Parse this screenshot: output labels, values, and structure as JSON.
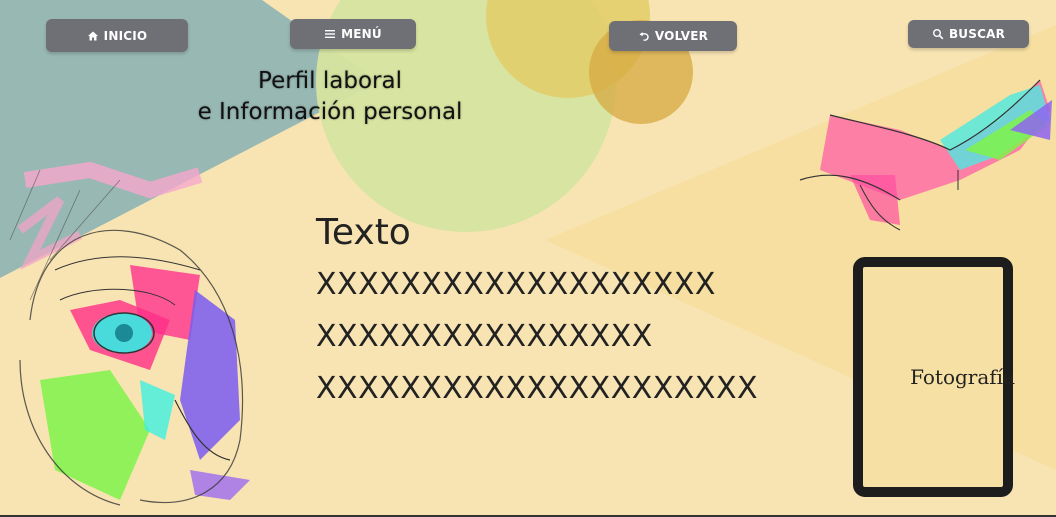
{
  "nav": {
    "inicio": "INICIO",
    "menu": "MENÚ",
    "volver": "VOLVER",
    "buscar": "BUSCAR"
  },
  "icons": {
    "inicio": "home-icon",
    "menu": "hamburger-menu-icon",
    "volver": "undo-arrow-icon",
    "buscar": "search-icon"
  },
  "header": {
    "title_line1": "Perfil laboral",
    "title_line2": "e Información personal"
  },
  "content": {
    "heading": "Texto",
    "lines": [
      "XXXXXXXXXXXXXXXXXXX",
      "XXXXXXXXXXXXXXXX",
      "XXXXXXXXXXXXXXXXXXXXX"
    ]
  },
  "photo": {
    "label": "Fotografía"
  },
  "colors": {
    "background": "#f8e4b2",
    "button": "#6f6f76",
    "teal_shape": "#9ab9b5",
    "green_circle": "#d5e2a2",
    "yellow_circle": "#e4c764"
  }
}
